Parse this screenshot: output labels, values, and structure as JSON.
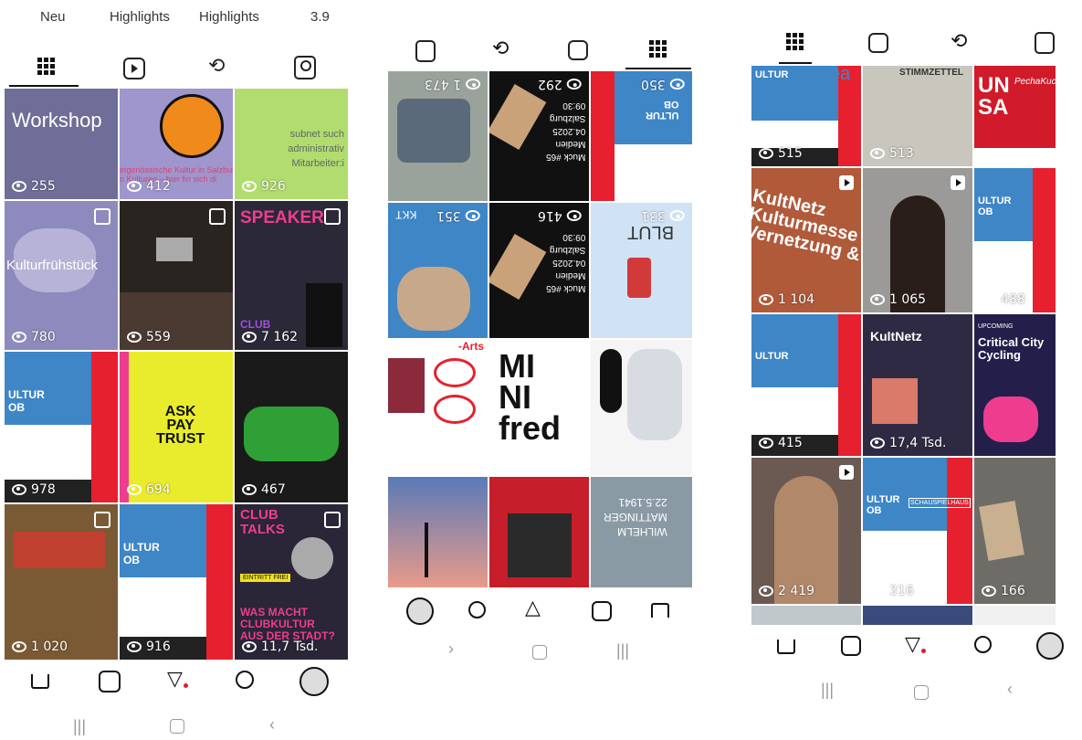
{
  "panel1": {
    "header": [
      "Neu",
      "Highlights",
      "Highlights",
      "3.9"
    ],
    "tiles": [
      {
        "text": "Workshop",
        "views": "255"
      },
      {
        "text": "etgenössische Kultur in Salzbur\nn Kulturen – hier fin sich di",
        "views": "412"
      },
      {
        "text": "subnet such\nadministrativ\nMitarbeiter:i",
        "views": "926"
      },
      {
        "text": "Kulturfrühstück",
        "views": "780"
      },
      {
        "text": "",
        "views": "559"
      },
      {
        "text": "SPEAKER",
        "sub": "CLUB",
        "views": "7 162"
      },
      {
        "text": "ULTUR\nOB",
        "views": "978"
      },
      {
        "text": "ASK\nPAY\nTRUST",
        "views": "694"
      },
      {
        "text": "",
        "views": "467"
      },
      {
        "text": "",
        "views": "1 020"
      },
      {
        "text": "ULTUR\nOB",
        "views": "916"
      },
      {
        "text": "CLUB\nTALKS",
        "sub": "WAS MACHT\nCLUBKULTUR\nAUS DER STADT?",
        "tag": "EINTRITT FREI",
        "views": "11,7 Tsd."
      }
    ]
  },
  "panel2": {
    "tiles": [
      {
        "views": "1 473"
      },
      {
        "text": "Muck #65\nMedien\n04.2025\nSalzburg\n09:30",
        "views": "292"
      },
      {
        "text": "ULTUR\nOB",
        "views": "350"
      },
      {
        "text": "KKT",
        "views": "351"
      },
      {
        "text": "Muck #65\nMedien\n04.2025\nSalzburg\n09:30",
        "views": "416"
      },
      {
        "text": "BLUT",
        "views": "331"
      },
      {
        "text": "-Arts"
      },
      {
        "text": "MI\nNI\nfred"
      },
      {
        "text": ""
      },
      {
        "text": ""
      },
      {
        "text": ""
      },
      {
        "text": "WILHELM\nMATTINGER\n22.5.1941"
      }
    ]
  },
  "panel3": {
    "tiles": [
      {
        "text": "ULTUR",
        "brand": "sea",
        "views": "515"
      },
      {
        "text": "STIMMZETTEL",
        "views": "513"
      },
      {
        "text": "UN\nSA",
        "sub": "PechaKucha",
        "views": ""
      },
      {
        "text": "KultNetz\nKulturmesse & Kulturbörse für\nVernetzung & Austausch",
        "views": "1 104"
      },
      {
        "text": "",
        "views": "1 065"
      },
      {
        "text": "ULTUR\nOB",
        "views": "488"
      },
      {
        "text": "ULTUR",
        "views": "415"
      },
      {
        "text": "KultNetz",
        "views": "17,4 Tsd."
      },
      {
        "text": "Critical City\nCycling",
        "sub": "UPCOMING",
        "views": ""
      },
      {
        "text": "",
        "views": "2 419"
      },
      {
        "text": "ULTUR\nOB",
        "sub": "SCHAUSPIELHAUS",
        "views": "316"
      },
      {
        "text": "",
        "views": "166"
      }
    ]
  },
  "nav": {
    "tabs": [
      "home",
      "reels",
      "send",
      "search",
      "profile"
    ]
  },
  "colors": {
    "kultur_blue": "#3f86c6",
    "red": "#e6202e",
    "accent_dot": "#e11d2a"
  }
}
